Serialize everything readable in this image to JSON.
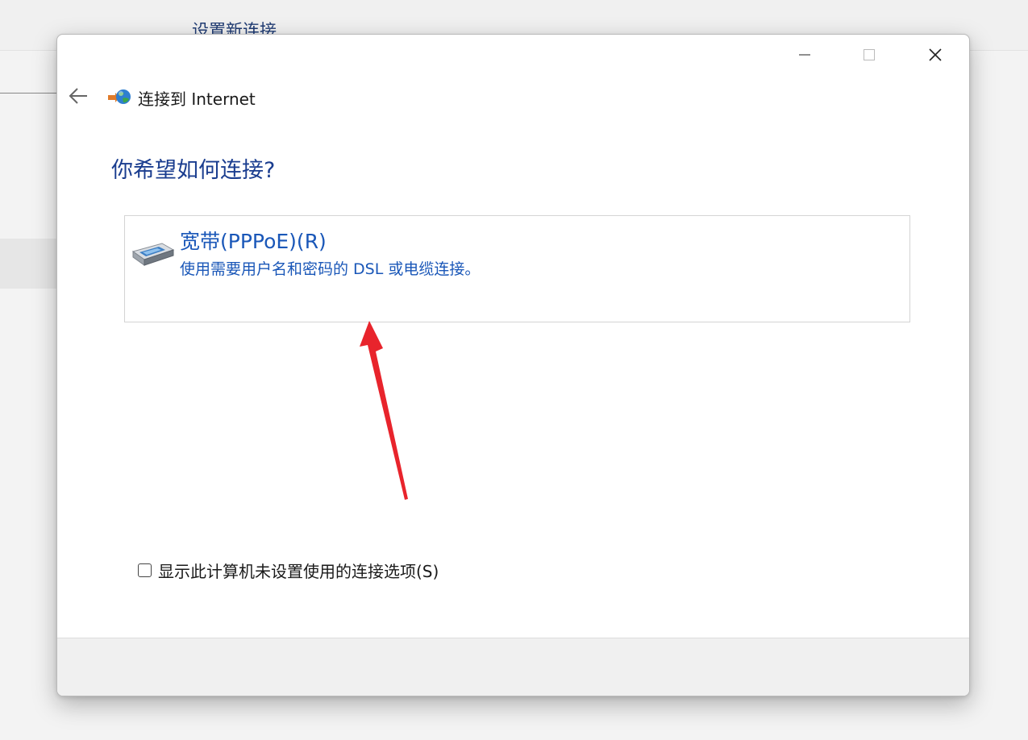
{
  "background": {
    "title": "设置新连接"
  },
  "dialog": {
    "window_controls": {
      "minimize_icon": "minimize-icon",
      "maximize_icon": "maximize-icon",
      "close_icon": "close-icon"
    },
    "wizard_title": "连接到 Internet",
    "heading": "你希望如何连接?",
    "options": [
      {
        "title": "宽带(PPPoE)(R)",
        "description": "使用需要用户名和密码的 DSL 或电缆连接。",
        "icon": "modem-icon"
      }
    ],
    "show_unsetup_label": "显示此计算机未设置使用的连接选项(S)",
    "show_unsetup_checked": false
  },
  "colors": {
    "heading": "#1a3d8f",
    "option_text": "#1a57b8",
    "annotation_arrow": "#e8242c"
  }
}
